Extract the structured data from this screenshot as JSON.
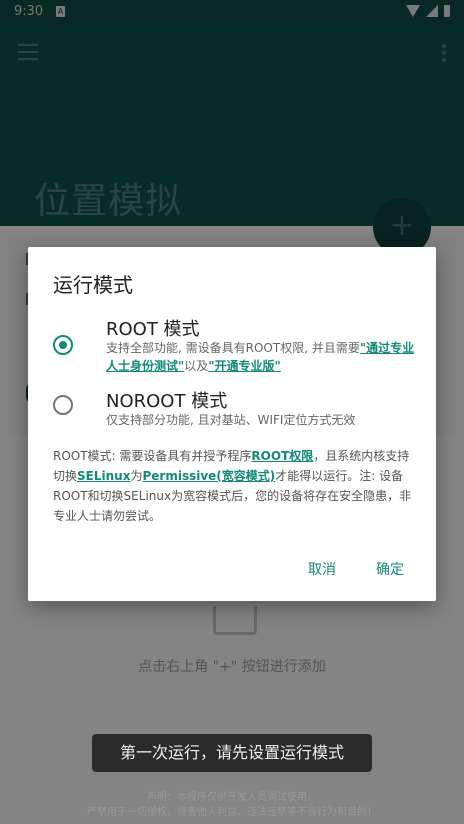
{
  "status": {
    "time": "9:30",
    "sim_label": "A"
  },
  "appbar": {
    "title": "位置模拟",
    "fab_label": "+"
  },
  "background": {
    "empty_text": "点击右上角 \"+\" 按钮进行添加",
    "toast": "第一次运行，请先设置运行模式",
    "disclaimer_line1": "声明：本程序仅供开发人员调试使用，",
    "disclaimer_line2": "严禁用于一切侵权、侵害他人利益、违法违禁等不当行为和目的！"
  },
  "dialog": {
    "title": "运行模式",
    "options": [
      {
        "title": "ROOT 模式",
        "selected": true,
        "desc_prefix": "支持全部功能, 需设备具有ROOT权限, 并且需要",
        "link1": "\"通过专业人士身份测试\"",
        "desc_mid": "以及",
        "link2": "\"开通专业版\""
      },
      {
        "title": "NOROOT 模式",
        "selected": false,
        "desc": "仅支持部分功能, 且对基站、WIFI定位方式无效"
      }
    ],
    "note": {
      "p1": "ROOT模式: 需要设备具有并授予程序",
      "l1": "ROOT权限",
      "p2": "，且系统内核支持切换",
      "l2": "SELinux",
      "p3": "为",
      "l3": "Permissive(宽容模式)",
      "p4": "才能得以运行。注: 设备ROOT和切换SELinux为宽容模式后，您的设备将存在安全隐患，非专业人士请勿尝试。"
    },
    "cancel_label": "取消",
    "ok_label": "确定"
  },
  "colors": {
    "accent": "#138a78",
    "appbar": "#0d5148",
    "statusbar": "#0f4a41"
  }
}
